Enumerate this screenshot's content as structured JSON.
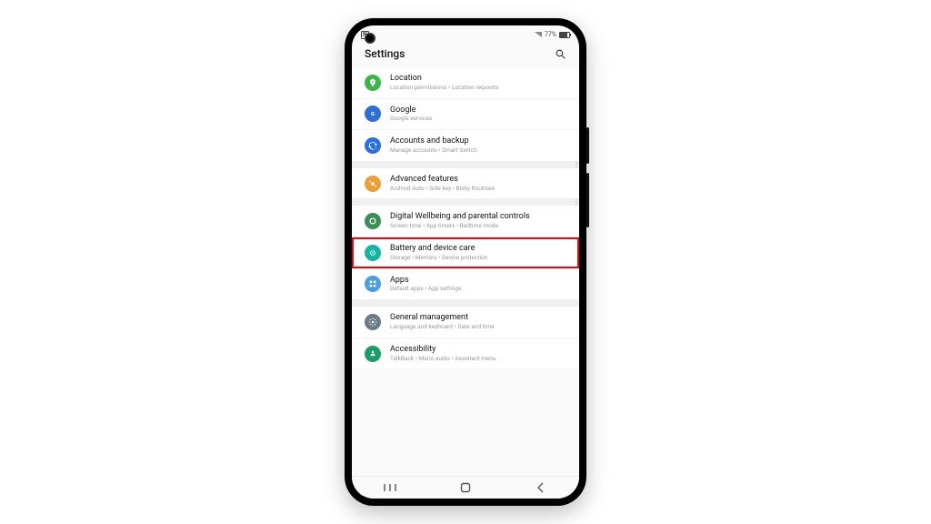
{
  "statusbar": {
    "battery": "77%"
  },
  "header": {
    "title": "Settings"
  },
  "groups": [
    [
      {
        "key": "location",
        "icon": "pin",
        "color": "#3bb54a",
        "title": "Location",
        "sub": "Location permissions  •  Location requests"
      },
      {
        "key": "google",
        "icon": "g",
        "color": "#2f6fd1",
        "title": "Google",
        "sub": "Google services"
      },
      {
        "key": "accounts",
        "icon": "sync",
        "color": "#2d6fd8",
        "title": "Accounts and backup",
        "sub": "Manage accounts  •  Smart Switch"
      }
    ],
    [
      {
        "key": "advanced",
        "icon": "sparkle",
        "color": "#e8a13a",
        "title": "Advanced features",
        "sub": "Android Auto  •  Side key  •  Bixby Routines"
      }
    ],
    [
      {
        "key": "wellbeing",
        "icon": "ring",
        "color": "#3a8f57",
        "title": "Digital Wellbeing and parental controls",
        "sub": "Screen time  •  App timers  •  Bedtime mode"
      },
      {
        "key": "battery",
        "icon": "care",
        "color": "#17b3a3",
        "title": "Battery and device care",
        "sub": "Storage  •  Memory  •  Device protection",
        "highlight": true
      },
      {
        "key": "apps",
        "icon": "grid",
        "color": "#4a9fe3",
        "title": "Apps",
        "sub": "Default apps  •  App settings"
      }
    ],
    [
      {
        "key": "general",
        "icon": "gear",
        "color": "#6b7a88",
        "title": "General management",
        "sub": "Language and keyboard  •  Date and time"
      },
      {
        "key": "accessibility",
        "icon": "person",
        "color": "#1d9c6a",
        "title": "Accessibility",
        "sub": "TalkBack  •  Mono audio  •  Assistant menu"
      }
    ]
  ]
}
